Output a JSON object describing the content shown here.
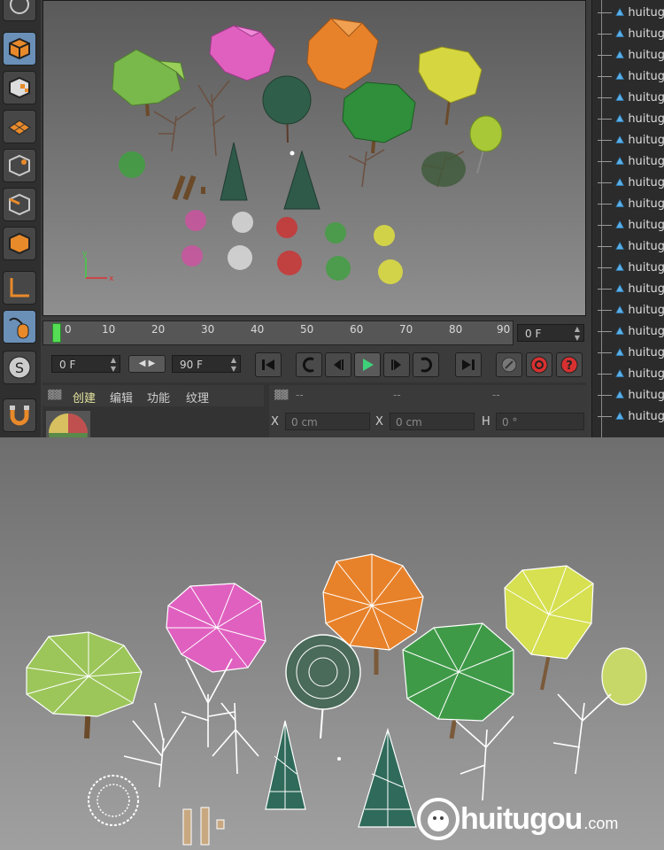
{
  "timeline": {
    "ticks": [
      "0",
      "10",
      "20",
      "30",
      "40",
      "50",
      "60",
      "70",
      "80",
      "90"
    ],
    "current_frame": "0 F"
  },
  "transport": {
    "start_frame": "0 F",
    "end_frame": "90 F"
  },
  "material_tabs": [
    "创建",
    "编辑",
    "功能",
    "纹理"
  ],
  "attributes": {
    "dashes": [
      "--",
      "--",
      "--"
    ],
    "x_label": "X",
    "x_value": "0 cm",
    "x2_label": "X",
    "x2_value": "0 cm",
    "h_label": "H",
    "h_value": "0 °"
  },
  "object_manager": {
    "items": [
      "huitug",
      "huitug",
      "huitug",
      "huitug",
      "huitug",
      "huitug",
      "huitug",
      "huitug",
      "huitug",
      "huitug",
      "huitug",
      "huitug",
      "huitug",
      "huitug",
      "huitug",
      "huitug",
      "huitug",
      "huitug",
      "huitug",
      "huitug"
    ]
  },
  "axis_labels": {
    "x": "x",
    "y": "y"
  },
  "watermark": {
    "brand": "huitugou",
    "suffix": ".com"
  },
  "colors": {
    "pink": "#e060c0",
    "orange": "#e8822a",
    "yellow": "#d6d640",
    "green_light": "#79b84a",
    "green_dark": "#2f8f3a",
    "teal": "#2f5f4a"
  }
}
